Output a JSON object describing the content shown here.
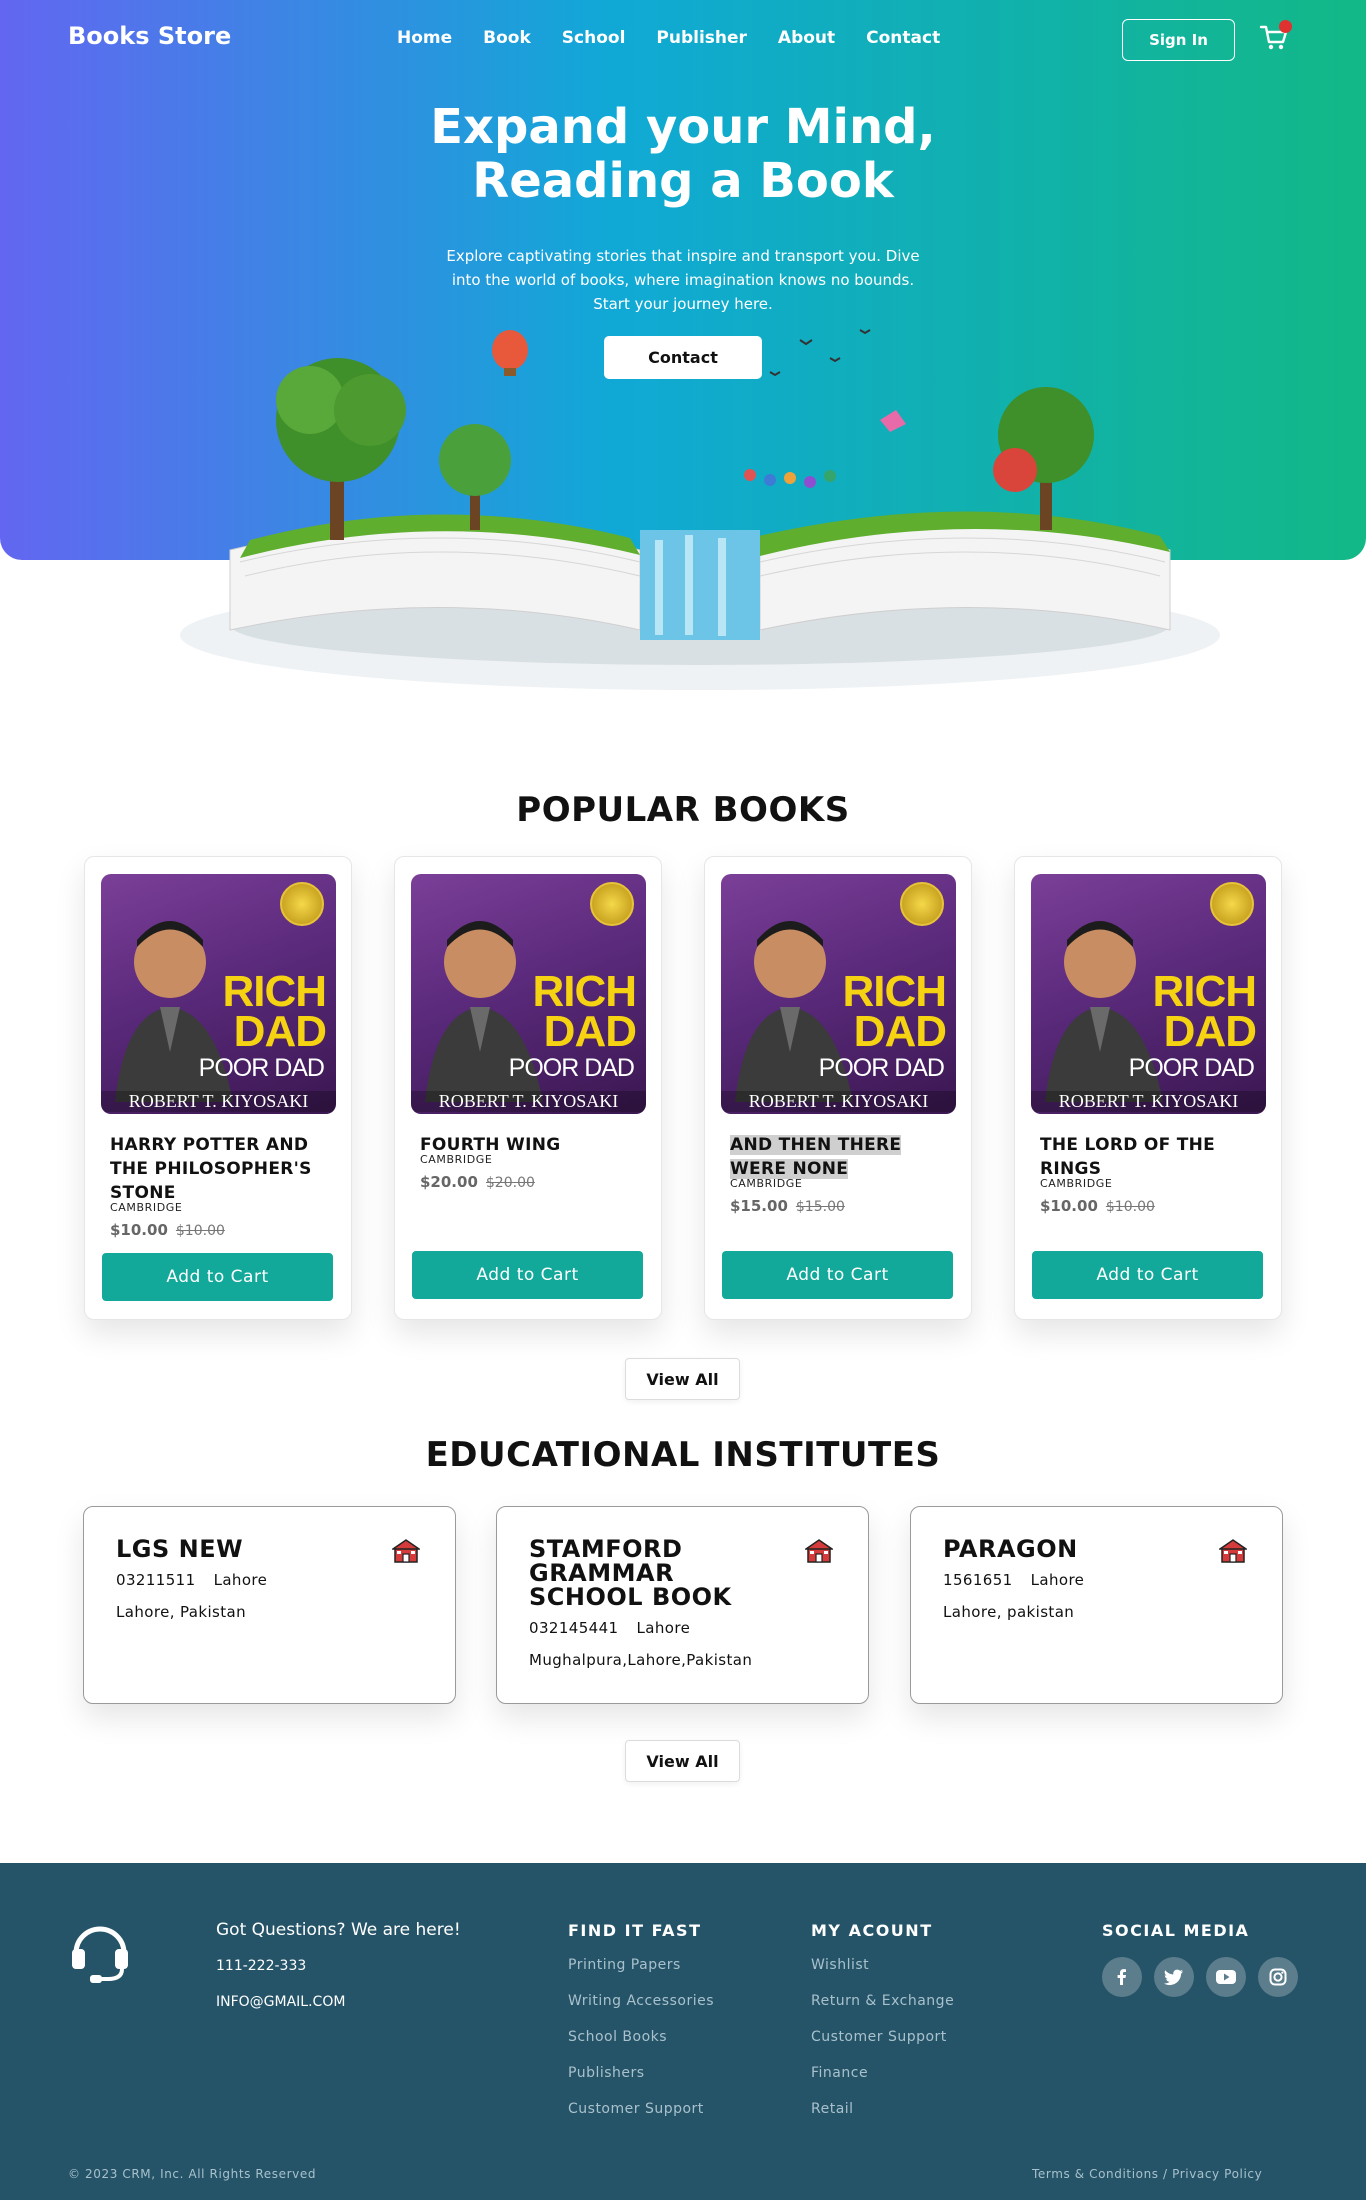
{
  "nav": {
    "brand": "Books Store",
    "links": [
      "Home",
      "Book",
      "School",
      "Publisher",
      "About",
      "Contact"
    ],
    "signin_label": "Sign In",
    "cart_icon": "cart-icon"
  },
  "hero": {
    "title_line1": "Expand your Mind,",
    "title_line2": "Reading a Book",
    "subtitle_line1": "Explore captivating stories that inspire and transport you. Dive",
    "subtitle_line2": "into the world of books, where imagination knows no bounds.",
    "subtitle_line3": "Start your journey here.",
    "button_label": "Contact"
  },
  "popular": {
    "title": "POPULAR BOOKS",
    "add_label": "Add to Cart",
    "view_all": "View All",
    "cover": {
      "rich": "RICH",
      "dad": "DAD",
      "poor_dad": "POOR DAD",
      "author": "ROBERT T. KIYOSAKI"
    },
    "books": [
      {
        "title": "HARRY POTTER AND THE PHILOSOPHER'S STONE",
        "publisher": "CAMBRIDGE",
        "price": "$10.00",
        "old_price": "$10.00"
      },
      {
        "title": "FOURTH WING",
        "publisher": "CAMBRIDGE",
        "price": "$20.00",
        "old_price": "$20.00"
      },
      {
        "title": "AND THEN THERE WERE NONE",
        "publisher": "CAMBRIDGE",
        "price": "$15.00",
        "old_price": "$15.00"
      },
      {
        "title": "THE LORD OF THE RINGS",
        "publisher": "CAMBRIDGE",
        "price": "$10.00",
        "old_price": "$10.00"
      }
    ]
  },
  "institutes": {
    "title": "EDUCATIONAL INSTITUTES",
    "view_all": "View All",
    "items": [
      {
        "name": "LGS NEW",
        "phone": "03211511",
        "city": "Lahore",
        "address": "Lahore, Pakistan"
      },
      {
        "name": "STAMFORD GRAMMAR SCHOOL BOOK",
        "phone": "032145441",
        "city": "Lahore",
        "address": "Mughalpura,Lahore,Pakistan"
      },
      {
        "name": "PARAGON",
        "phone": "1561651",
        "city": "Lahore",
        "address": "Lahore, pakistan"
      }
    ]
  },
  "footer": {
    "question": "Got Questions? We are here!",
    "phone": "111-222-333",
    "email": "INFO@GMAIL.COM",
    "find_title": "FIND IT FAST",
    "find_items": [
      "Printing Papers",
      "Writing Accessories",
      "School Books",
      "Publishers",
      "Customer Support"
    ],
    "account_title": "MY ACOUNT",
    "account_items": [
      "Wishlist",
      "Return & Exchange",
      "Customer Support",
      "Finance",
      "Retail"
    ],
    "social_title": "SOCIAL MEDIA",
    "social_icons": [
      "facebook-icon",
      "twitter-icon",
      "youtube-icon",
      "instagram-icon"
    ],
    "copyright": "© 2023 CRM, Inc. All Rights Reserved",
    "legal": "Terms & Conditions / Privacy Policy"
  },
  "colors": {
    "hero_start": "#6366f1",
    "hero_mid": "#10a9d6",
    "hero_end": "#12b886",
    "accent": "#12a99b",
    "footer": "#255468"
  }
}
